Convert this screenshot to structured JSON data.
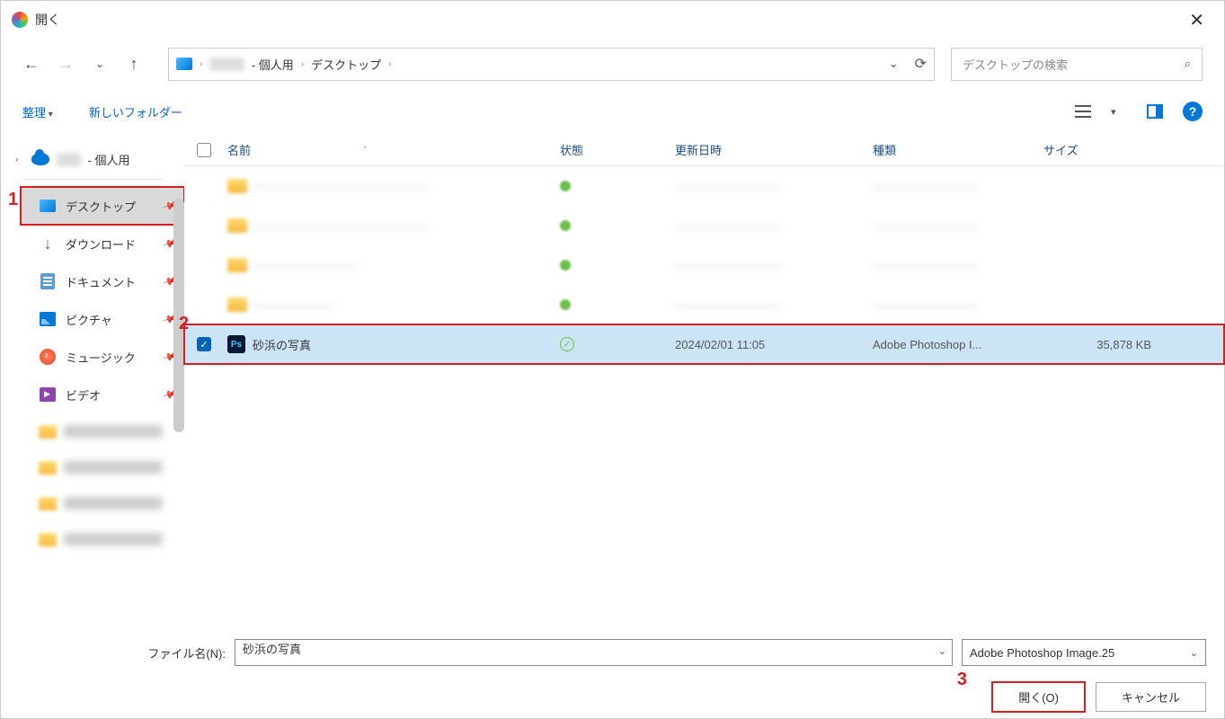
{
  "titlebar": {
    "title": "開く"
  },
  "breadcrumbs": {
    "redacted": "———",
    "personal": " - 個人用",
    "desktop": "デスクトップ"
  },
  "search": {
    "placeholder": "デスクトップの検索"
  },
  "toolbar": {
    "organize": "整理",
    "newfolder": "新しいフォルダー"
  },
  "tree": {
    "onedrive_personal": " - 個人用",
    "desktop": "デスクトップ",
    "downloads": "ダウンロード",
    "documents": "ドキュメント",
    "pictures": "ピクチャ",
    "music": "ミュージック",
    "videos": "ビデオ"
  },
  "columns": {
    "name": "名前",
    "state": "状態",
    "date": "更新日時",
    "type": "種類",
    "size": "サイズ"
  },
  "selected_file": {
    "name": "砂浜の写真",
    "date": "2024/02/01 11:05",
    "type": "Adobe Photoshop I...",
    "size": "35,878 KB"
  },
  "footer": {
    "filename_label": "ファイル名(N):",
    "filename_value": "砂浜の写真",
    "filetype": "Adobe Photoshop Image.25",
    "open": "開く(O)",
    "cancel": "キャンセル"
  },
  "annotations": {
    "n1": "1",
    "n2": "2",
    "n3": "3"
  }
}
